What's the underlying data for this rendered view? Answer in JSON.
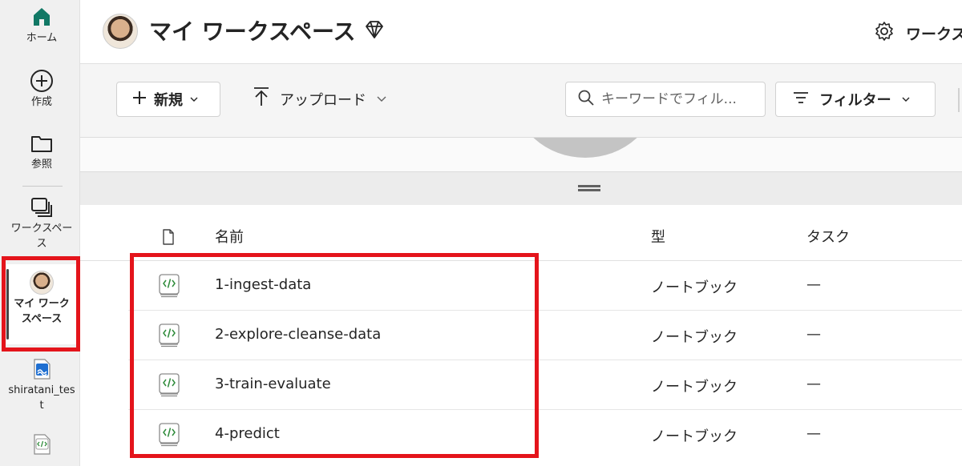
{
  "rail": {
    "home": "ホーム",
    "create": "作成",
    "browse": "参照",
    "workspaces": "ワークスペース",
    "my_workspace": "マイ ワークスペース",
    "item1": "shiratani_test"
  },
  "header": {
    "title": "マイ ワークスペース",
    "settings_label": "ワークス"
  },
  "toolbar": {
    "new_label": "新規",
    "upload_label": "アップロード",
    "search_placeholder": "キーワードでフィル...",
    "filter_label": "フィルター"
  },
  "table": {
    "columns": [
      "名前",
      "型",
      "タスク"
    ],
    "rows": [
      {
        "name": "1-ingest-data",
        "type": "ノートブック",
        "task": "—"
      },
      {
        "name": "2-explore-cleanse-data",
        "type": "ノートブック",
        "task": "—"
      },
      {
        "name": "3-train-evaluate",
        "type": "ノートブック",
        "task": "—"
      },
      {
        "name": "4-predict",
        "type": "ノートブック",
        "task": "—"
      }
    ]
  },
  "colors": {
    "accent": "#117865",
    "highlight": "#e4141b"
  }
}
